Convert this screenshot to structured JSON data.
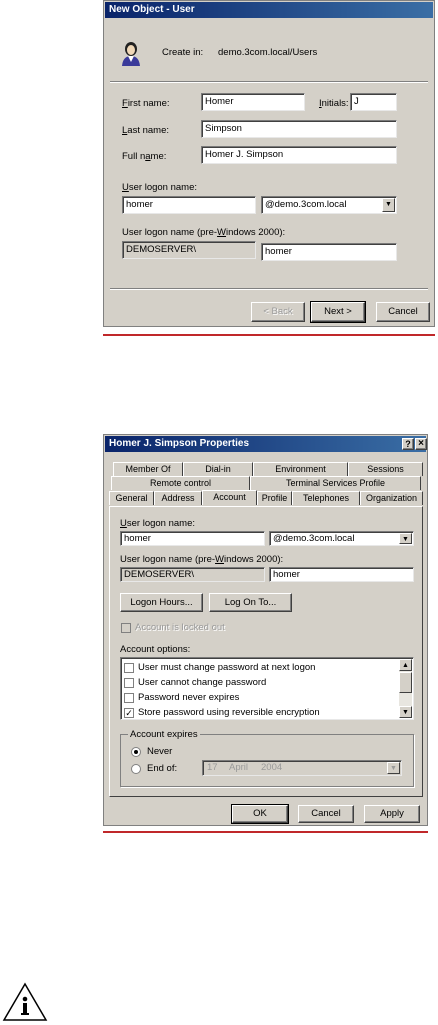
{
  "new_user": {
    "title": "New Object - User",
    "create_in_label": "Create in:",
    "create_in_value": "demo.3com.local/Users",
    "first_name_label": "First name:",
    "first_name": "Homer",
    "initials_label": "Initials:",
    "initials": "J",
    "last_name_label": "Last name:",
    "last_name": "Simpson",
    "full_name_label": "Full name:",
    "full_name": "Homer J. Simpson",
    "logon_label": "User logon name:",
    "logon_value": "homer",
    "domain_value": "@demo.3com.local",
    "pre2000_label": "User logon name (pre-Windows 2000):",
    "pre2000_domain": "DEMOSERVER\\",
    "pre2000_value": "homer",
    "back_label": "< Back",
    "next_label": "Next >",
    "cancel_label": "Cancel"
  },
  "props": {
    "title": "Homer J. Simpson Properties",
    "help_btn": "?",
    "close_btn": "×",
    "tabs_row1": [
      "Member Of",
      "Dial-in",
      "Environment",
      "Sessions"
    ],
    "tabs_row2": [
      "Remote control",
      "Terminal Services Profile"
    ],
    "tabs_row3": [
      "General",
      "Address",
      "Account",
      "Profile",
      "Telephones",
      "Organization"
    ],
    "logon_label": "User logon name:",
    "logon_value": "homer",
    "domain_value": "@demo.3com.local",
    "pre2000_label": "User logon name (pre-Windows 2000):",
    "pre2000_domain": "DEMOSERVER\\",
    "pre2000_value": "homer",
    "logon_hours": "Logon Hours...",
    "log_on_to": "Log On To...",
    "locked_out": "Account is locked out",
    "options_label": "Account options:",
    "options": [
      {
        "label": "User must change password at next logon",
        "checked": false
      },
      {
        "label": "User cannot change password",
        "checked": false
      },
      {
        "label": "Password never expires",
        "checked": false
      },
      {
        "label": "Store password using reversible encryption",
        "checked": true
      }
    ],
    "expires_label": "Account expires",
    "never_label": "Never",
    "end_of_label": "End of:",
    "date_day": "17",
    "date_month": "April",
    "date_year": "2004",
    "ok_label": "OK",
    "cancel_label": "Cancel",
    "apply_label": "Apply"
  },
  "note_icon": "info-icon"
}
